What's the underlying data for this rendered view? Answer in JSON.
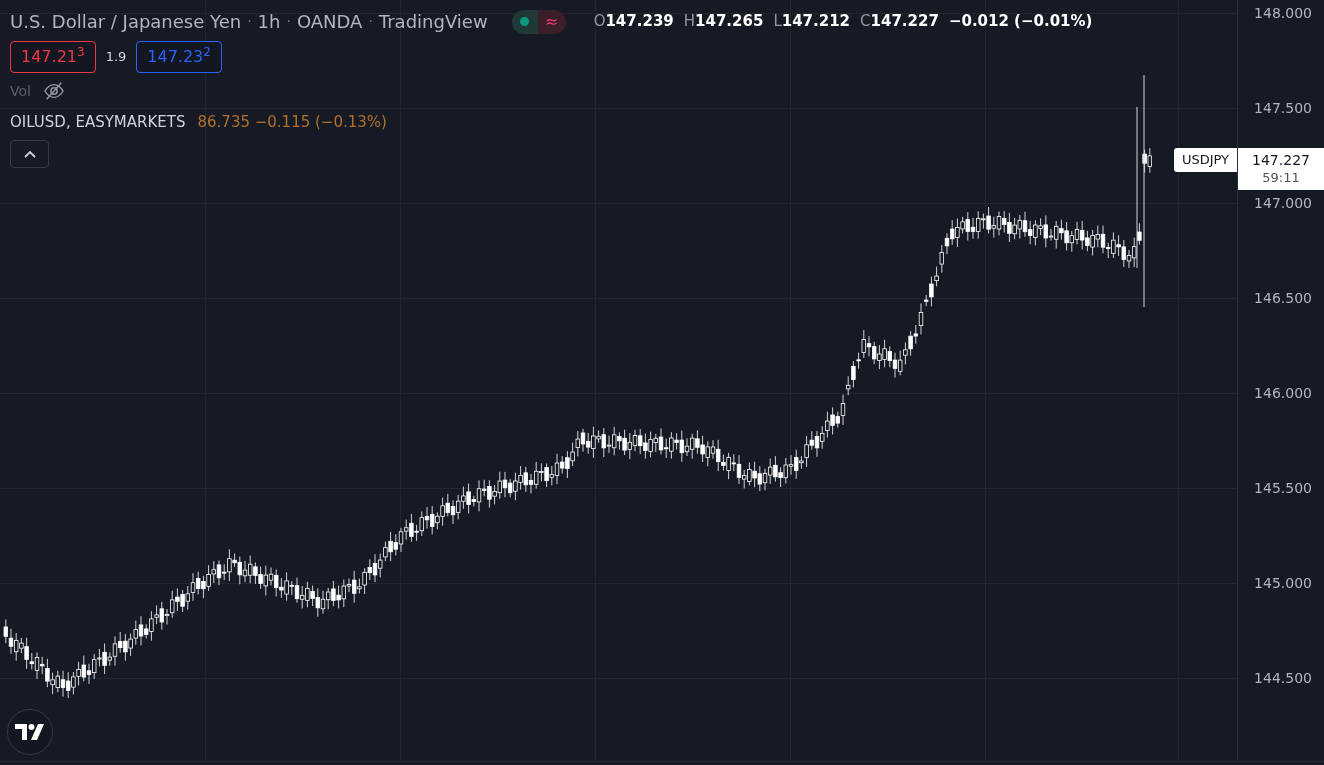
{
  "header": {
    "title_parts": [
      "U.S. Dollar / Japanese Yen",
      "1h",
      "OANDA",
      "TradingView"
    ],
    "separator": "·",
    "market_status": {
      "open": true,
      "indicator": "≈"
    },
    "ohlc": [
      {
        "label": "O",
        "value": "147.239"
      },
      {
        "label": "H",
        "value": "147.265"
      },
      {
        "label": "L",
        "value": "147.212"
      },
      {
        "label": "C",
        "value": "147.227"
      }
    ],
    "change": "−0.012 (−0.01%)"
  },
  "trade": {
    "sell": "147.21$^{3}$",
    "spread": "1.9",
    "buy": "147.23$^{2}$"
  },
  "volume": {
    "label": "Vol",
    "visible": false
  },
  "compare": {
    "symbol": "OILUSD, EASYMARKETS",
    "values": "86.735 −0.115 (−0.13%)"
  },
  "legend_expanded": true,
  "price_axis": {
    "ticks": [
      "148.000",
      "147.500",
      "147.000",
      "146.500",
      "146.000",
      "145.500",
      "145.000",
      "144.500"
    ]
  },
  "last_price": {
    "symbol": "USDJPY",
    "price": "147.227",
    "countdown": "59:11"
  }
}
